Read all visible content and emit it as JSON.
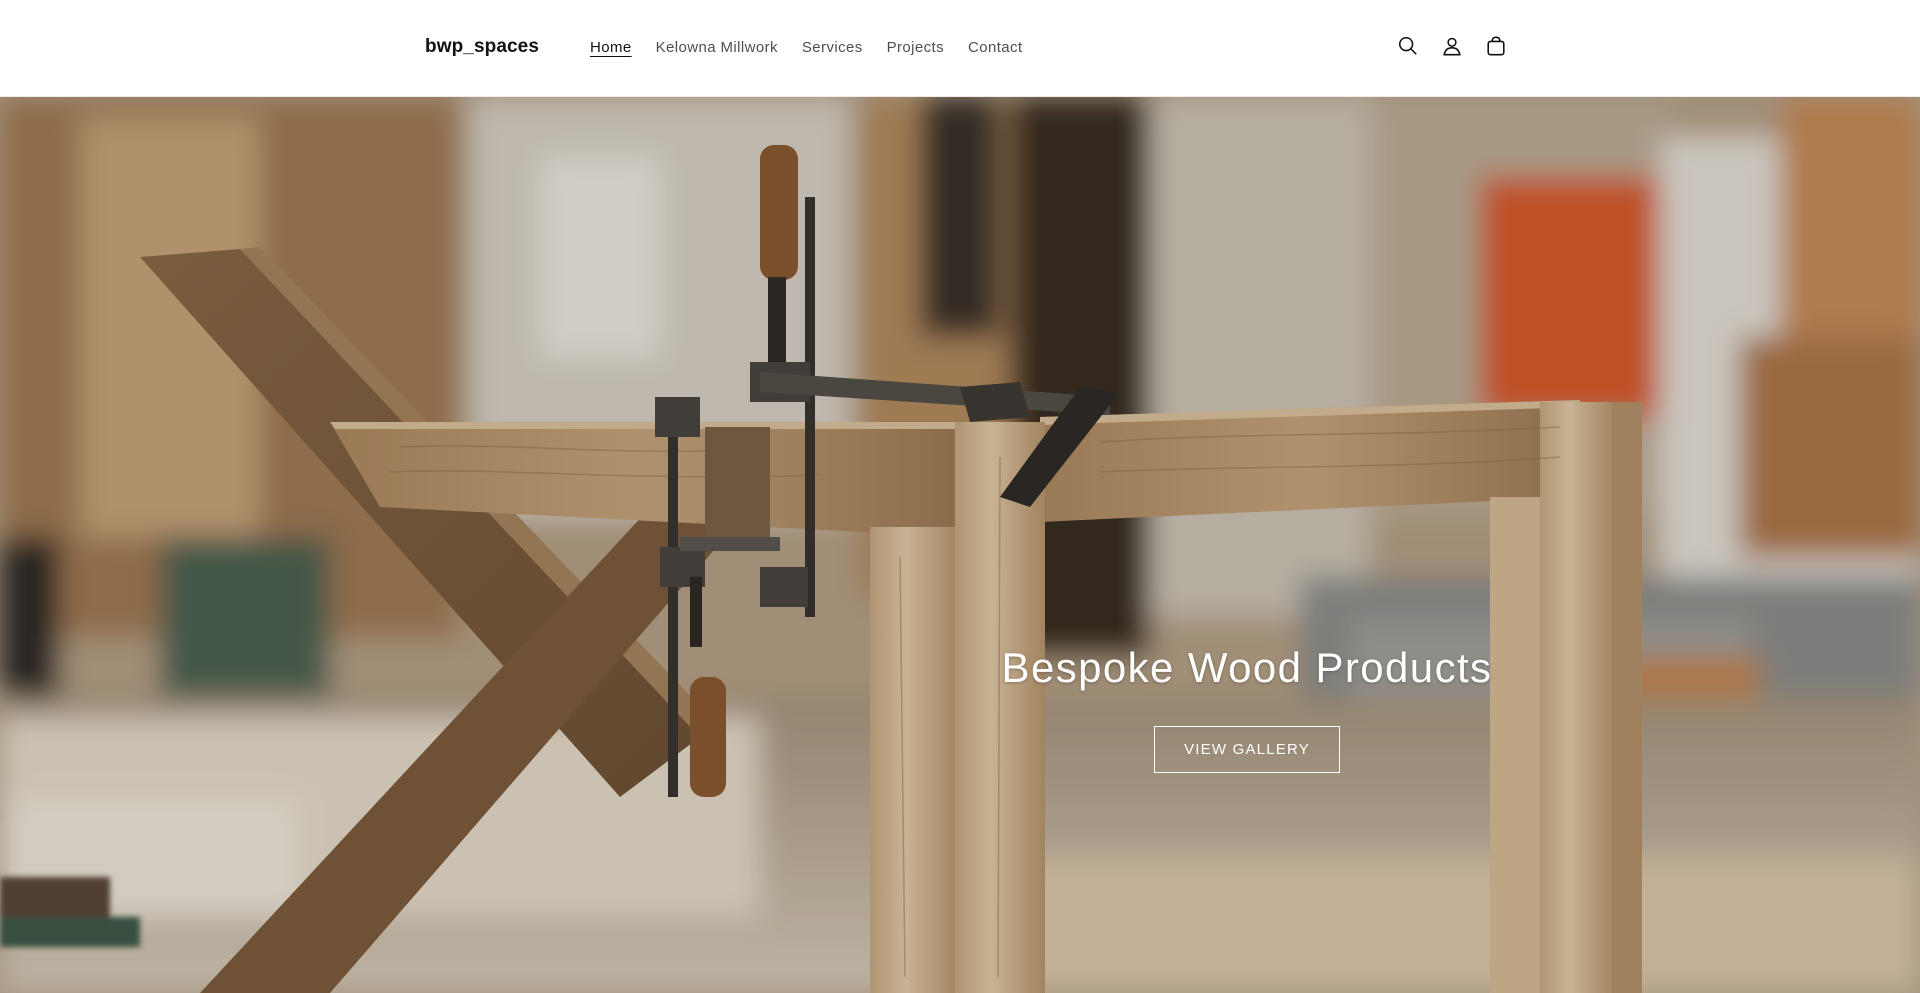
{
  "header": {
    "logo": "bwp_spaces",
    "nav": [
      {
        "label": "Home",
        "active": true
      },
      {
        "label": "Kelowna Millwork",
        "active": false
      },
      {
        "label": "Services",
        "active": false
      },
      {
        "label": "Projects",
        "active": false
      },
      {
        "label": "Contact",
        "active": false
      }
    ],
    "icons": [
      "search-icon",
      "account-icon",
      "cart-icon"
    ]
  },
  "hero": {
    "title": "Bespoke Wood Products",
    "button_label": "VIEW GALLERY",
    "image": "woodworking-clamps-on-table-frame"
  },
  "colors": {
    "text_dark": "#121212",
    "header_bg": "#ffffff",
    "hero_text": "#ffffff",
    "wood_light": "#c9a67e",
    "wood_dark": "#7a5a3c"
  }
}
